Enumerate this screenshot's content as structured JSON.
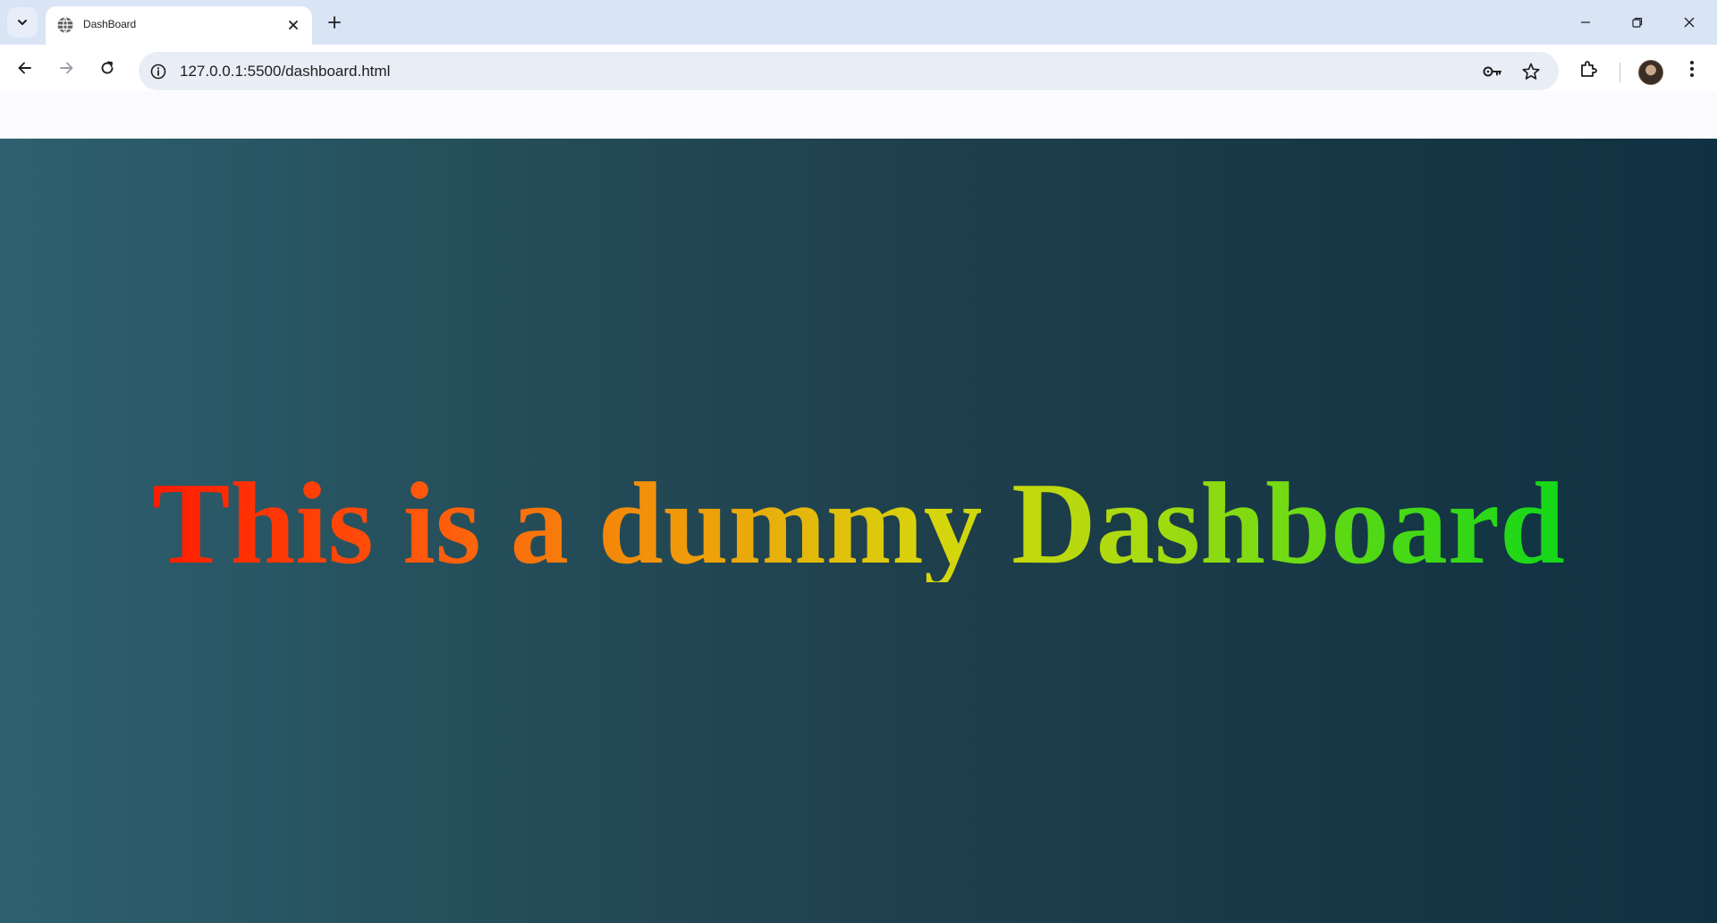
{
  "tab": {
    "title": "DashBoard",
    "favicon": "globe-icon"
  },
  "toolbar": {
    "url": "127.0.0.1:5500/dashboard.html"
  },
  "page": {
    "headline": "This is a dummy Dashboard",
    "colors": {
      "background_start": "#2e6070",
      "background_end": "#0f3141",
      "text_gradient": [
        "#ff1b00",
        "#ef9c0a",
        "#d8d50c",
        "#12d718"
      ]
    }
  }
}
